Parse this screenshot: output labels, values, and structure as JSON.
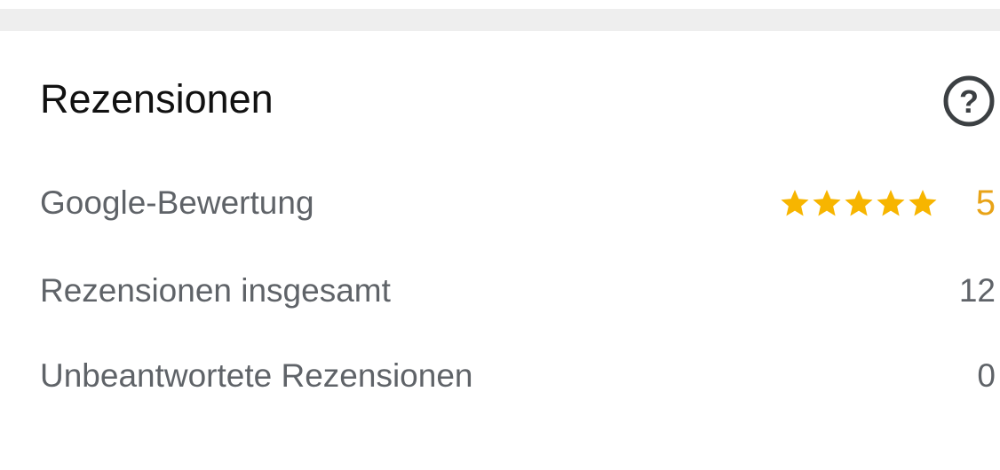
{
  "colors": {
    "accent_star": "#F7B500",
    "rating_text": "#E8A317",
    "label_text": "#5F6368",
    "title_text": "#111111",
    "top_band": "#EEEEEE"
  },
  "section": {
    "title": "Rezensionen",
    "help_icon": "question-circle-icon"
  },
  "rows": [
    {
      "label": "Google-Bewertung",
      "value": "5",
      "rating": 5,
      "rating_max": 5
    },
    {
      "label": "Rezensionen insgesamt",
      "value": "12"
    },
    {
      "label": "Unbeantwortete Rezensionen",
      "value": "0"
    }
  ]
}
